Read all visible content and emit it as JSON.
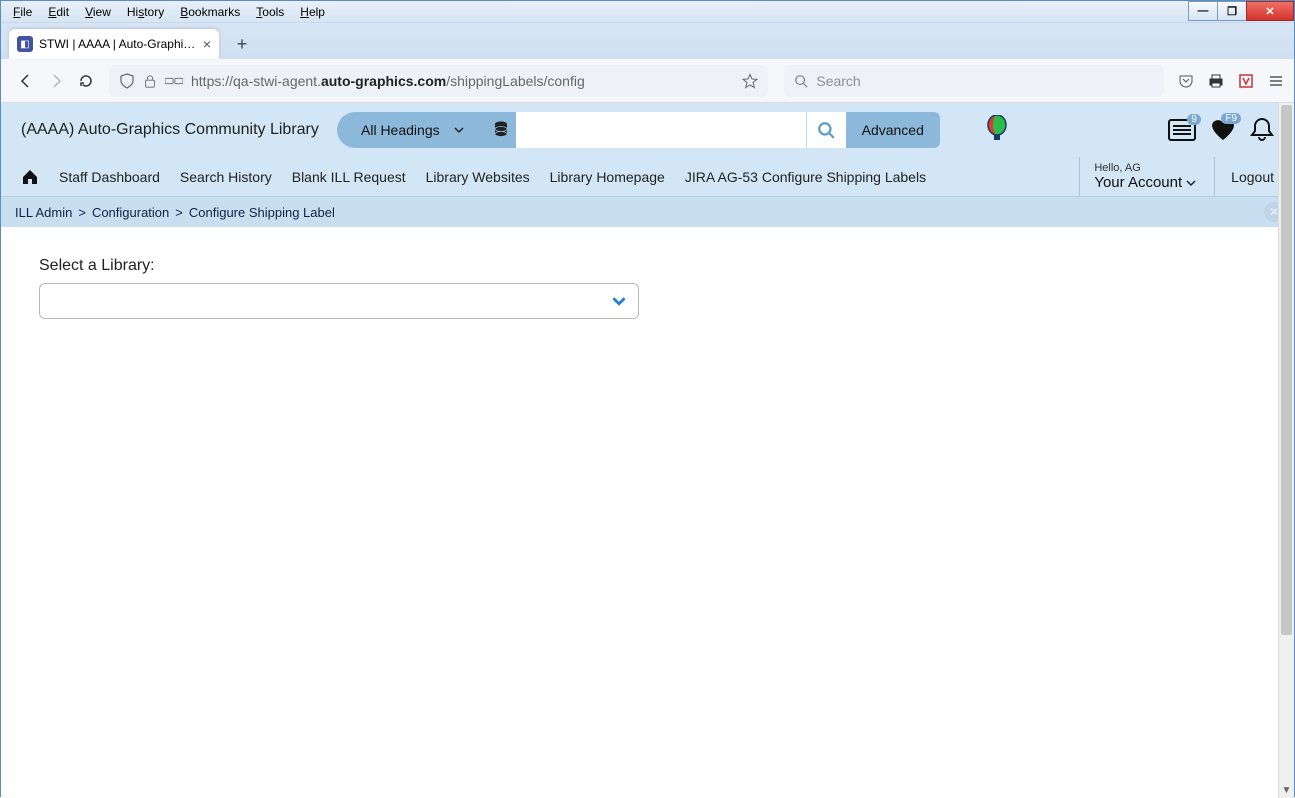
{
  "browser": {
    "menus": {
      "file": "File",
      "edit": "Edit",
      "view": "View",
      "history": "History",
      "bookmarks": "Bookmarks",
      "tools": "Tools",
      "help": "Help"
    },
    "tab_title": "STWI | AAAA | Auto-Graphics In",
    "url_prefix": "https://qa-stwi-agent.",
    "url_bold": "auto-graphics.com",
    "url_suffix": "/shippingLabels/config",
    "search_placeholder": "Search"
  },
  "app": {
    "library_name": "(AAAA) Auto-Graphics Community Library",
    "headings_label": "All Headings",
    "advanced_label": "Advanced",
    "list_badge": "9",
    "heart_badge": "F9",
    "nav": {
      "staff_dashboard": "Staff Dashboard",
      "search_history": "Search History",
      "blank_ill": "Blank ILL Request",
      "library_websites": "Library Websites",
      "library_homepage": "Library Homepage",
      "jira": "JIRA AG-53 Configure Shipping Labels"
    },
    "hello": "Hello, AG",
    "your_account": "Your Account",
    "logout": "Logout",
    "breadcrumb": {
      "a": "ILL Admin",
      "b": "Configuration",
      "c": "Configure Shipping Label"
    },
    "select_label": "Select a Library:"
  }
}
